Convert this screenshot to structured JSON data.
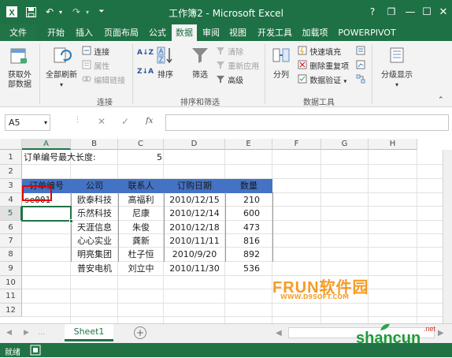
{
  "window": {
    "title": "工作簿2 - Microsoft Excel",
    "controls": {
      "help": "?",
      "restore": "❐",
      "minimize": "—",
      "maximize": "☐",
      "close": "✕"
    }
  },
  "quick_access": {
    "undo": "↶",
    "redo": "↷"
  },
  "tabs": [
    "文件",
    "开始",
    "插入",
    "页面布局",
    "公式",
    "数据",
    "审阅",
    "视图",
    "开发工具",
    "加载项",
    "POWERPIVOT"
  ],
  "active_tab": "数据",
  "ribbon": {
    "get_external": "获取外部数据",
    "refresh_all": "全部刷新",
    "connections": "连接",
    "properties": "属性",
    "edit_links": "编辑链接",
    "group_connections": "连接",
    "sort_az": "A↓Z",
    "sort_za": "Z↓A",
    "sort": "排序",
    "filter": "筛选",
    "clear": "清除",
    "reapply": "重新应用",
    "advanced": "高级",
    "group_sort_filter": "排序和筛选",
    "text_to_columns": "分列",
    "flash_fill": "快速填充",
    "remove_duplicates": "删除重复项",
    "data_validation": "数据验证",
    "group_data_tools": "数据工具",
    "outline": "分级显示"
  },
  "formula_bar": {
    "name_box": "A5",
    "fx": "fx",
    "cancel": "✕",
    "enter": "✓",
    "content": ""
  },
  "columns": [
    "A",
    "B",
    "C",
    "D",
    "E",
    "F",
    "G",
    "H"
  ],
  "rows": [
    "1",
    "2",
    "3",
    "4",
    "5",
    "6",
    "7",
    "8",
    "9",
    "10",
    "11",
    "12"
  ],
  "cells": {
    "label_max_len": "订单编号最大长度:",
    "max_len_value": "5",
    "headers": [
      "订单编号",
      "公司",
      "联系人",
      "订购日期",
      "数量"
    ],
    "table": [
      [
        "se001",
        "欧泰科技",
        "高福利",
        "2010/12/15",
        "210"
      ],
      [
        "",
        "乐然科技",
        "尼康",
        "2010/12/14",
        "600"
      ],
      [
        "",
        "天涯信息",
        "朱俊",
        "2010/12/18",
        "473"
      ],
      [
        "",
        "心心实业",
        "龚新",
        "2010/11/11",
        "816"
      ],
      [
        "",
        "明亮集团",
        "杜子恒",
        "2010/9/20",
        "892"
      ],
      [
        "",
        "普安电机",
        "刘立中",
        "2010/11/30",
        "536"
      ]
    ]
  },
  "sheets": [
    "Sheet1"
  ],
  "status": "就绪",
  "watermark": {
    "top": "FRUN软件园",
    "url": "WWW.D9SOFT.COM",
    "brand": "shancun",
    "suffix": ".net"
  },
  "colors": {
    "excel_green": "#1e7145",
    "header_fill": "#4472c4",
    "highlight_red": "#e60000",
    "selection_green": "#217346"
  }
}
